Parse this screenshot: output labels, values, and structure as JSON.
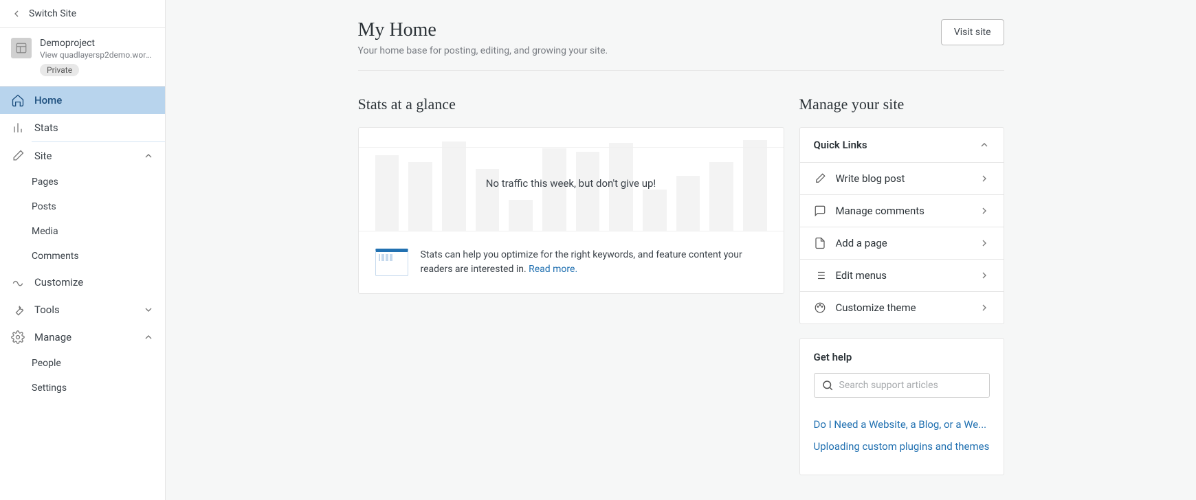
{
  "sidebar": {
    "switch_label": "Switch Site",
    "site_name": "Demoproject",
    "site_url": "View quadlayersp2demo.wordpress...",
    "badge": "Private",
    "nav": {
      "home": "Home",
      "stats": "Stats",
      "site": "Site",
      "pages": "Pages",
      "posts": "Posts",
      "media": "Media",
      "comments": "Comments",
      "customize": "Customize",
      "tools": "Tools",
      "manage": "Manage",
      "people": "People",
      "settings": "Settings"
    }
  },
  "header": {
    "title": "My Home",
    "subtitle": "Your home base for posting, editing, and growing your site.",
    "visit_btn": "Visit site"
  },
  "stats": {
    "title": "Stats at a glance",
    "no_traffic": "No traffic this week, but don't give up!",
    "tip_text": "Stats can help you optimize for the right keywords, and feature content your readers are interested in. ",
    "tip_link": "Read more."
  },
  "manage_site": {
    "title": "Manage your site",
    "quick_links_title": "Quick Links",
    "items": [
      {
        "label": "Write blog post"
      },
      {
        "label": "Manage comments"
      },
      {
        "label": "Add a page"
      },
      {
        "label": "Edit menus"
      },
      {
        "label": "Customize theme"
      }
    ]
  },
  "help": {
    "title": "Get help",
    "placeholder": "Search support articles",
    "links": [
      "Do I Need a Website, a Blog, or a We...",
      "Uploading custom plugins and themes"
    ]
  }
}
